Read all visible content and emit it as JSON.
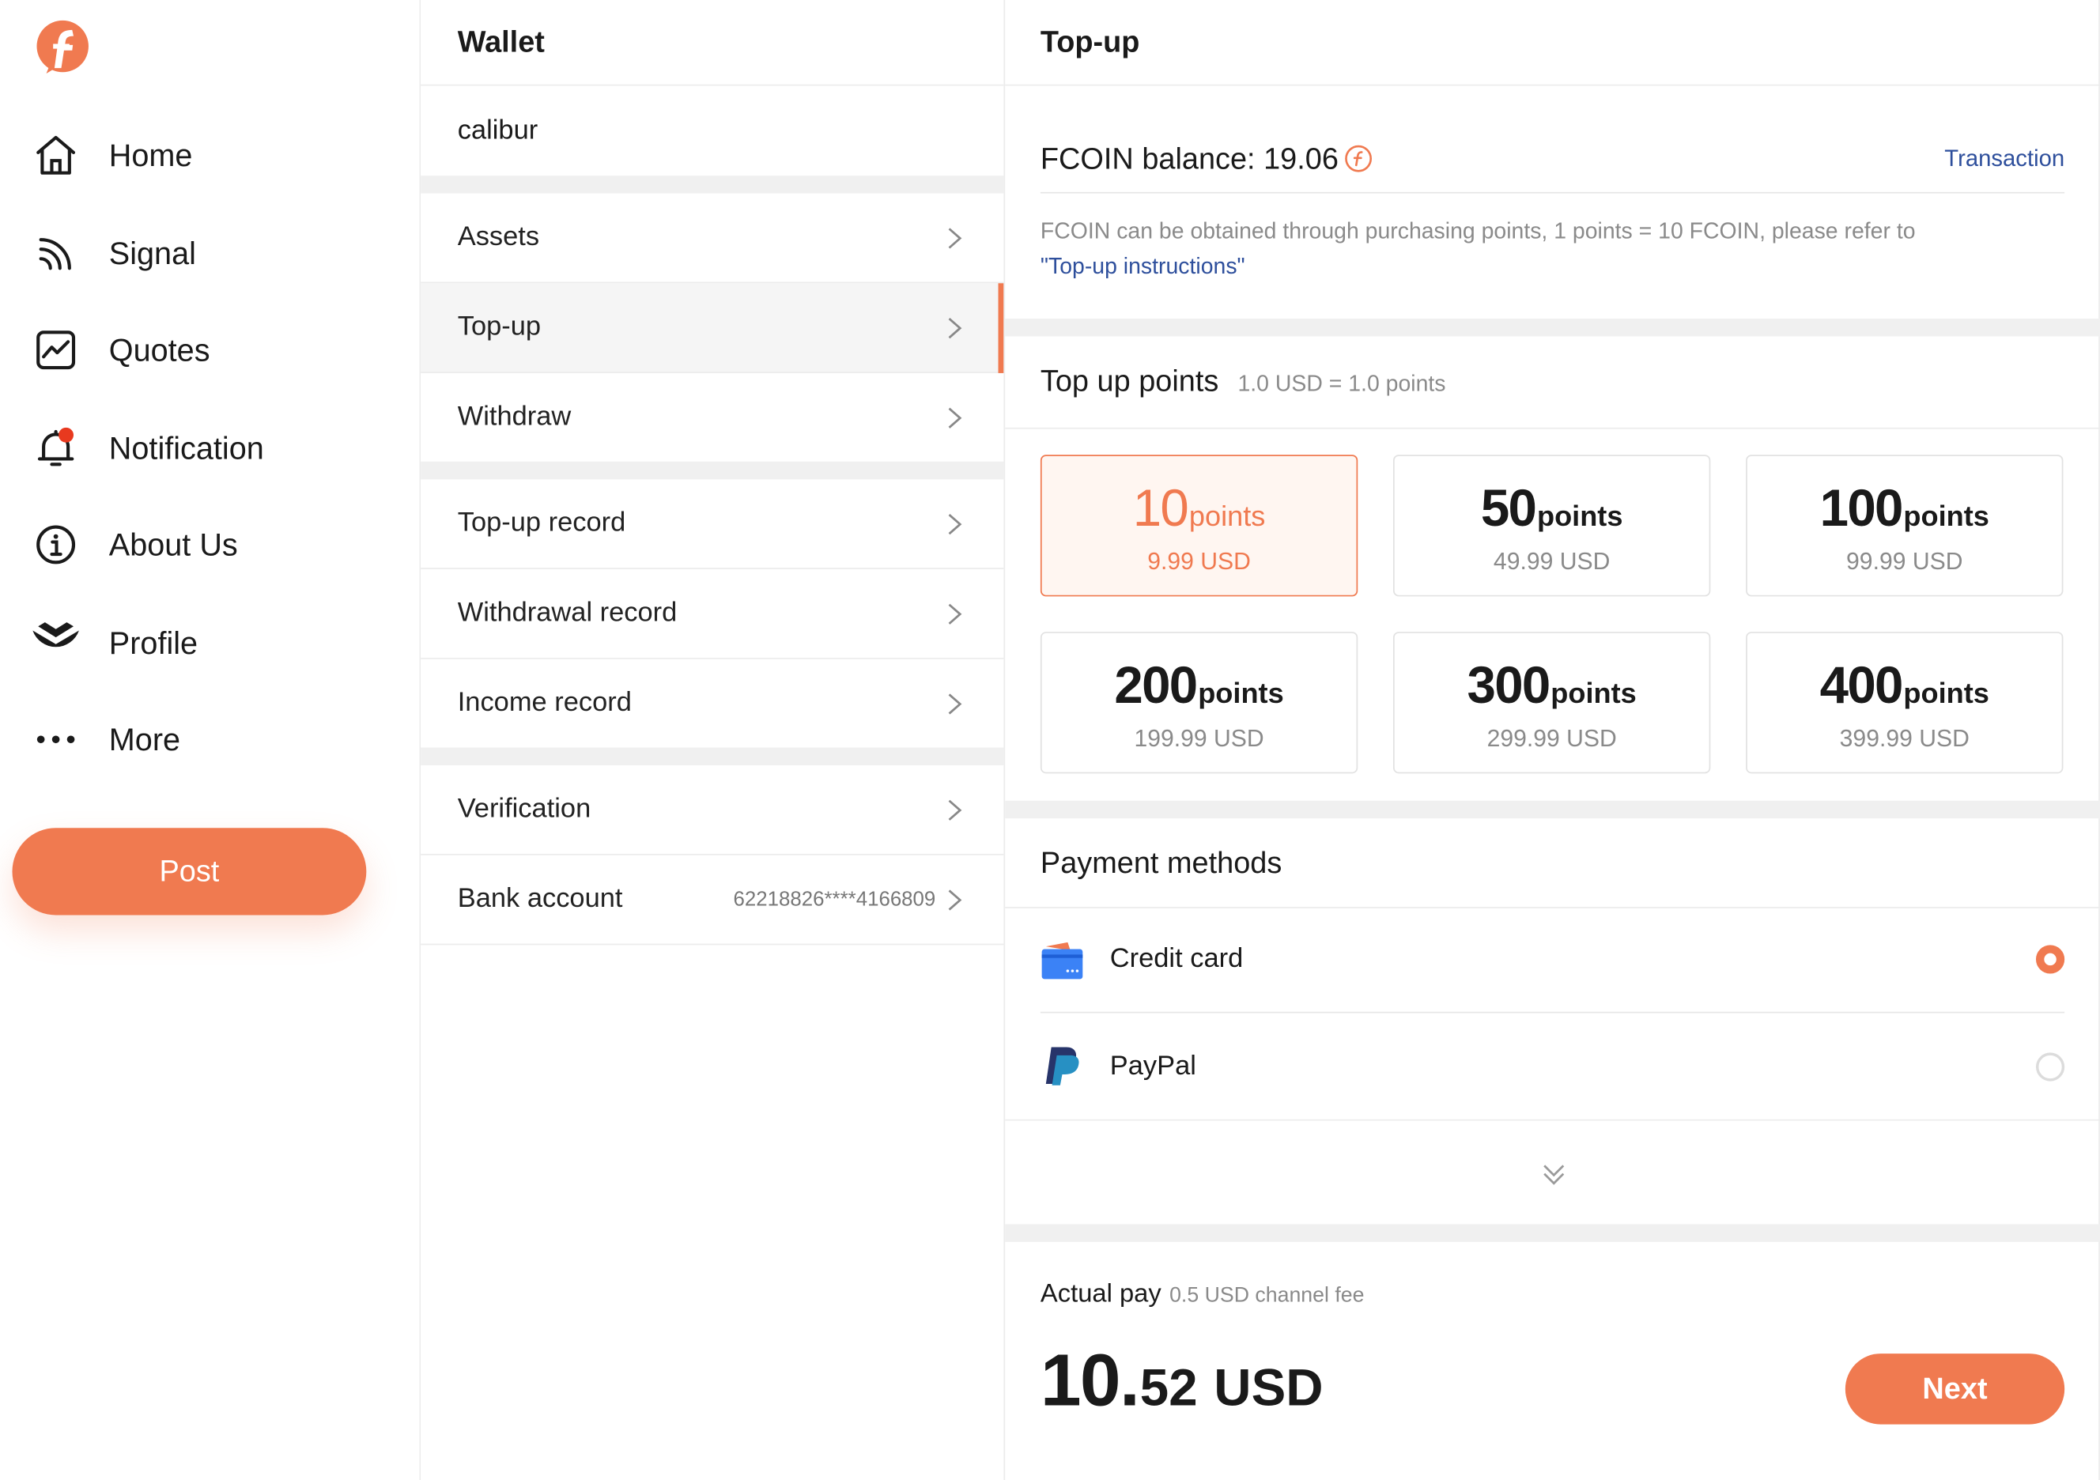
{
  "nav": {
    "items": [
      {
        "label": "Home",
        "icon": "home-icon"
      },
      {
        "label": "Signal",
        "icon": "signal-icon"
      },
      {
        "label": "Quotes",
        "icon": "quotes-icon"
      },
      {
        "label": "Notification",
        "icon": "bell-icon"
      },
      {
        "label": "About Us",
        "icon": "info-icon"
      },
      {
        "label": "Profile",
        "icon": "profile-icon"
      },
      {
        "label": "More",
        "icon": "more-dots-icon"
      }
    ],
    "post_label": "Post"
  },
  "wallet": {
    "title": "Wallet",
    "username": "calibur",
    "items": [
      {
        "label": "Assets"
      },
      {
        "label": "Top-up"
      },
      {
        "label": "Withdraw"
      },
      {
        "label": "Top-up record"
      },
      {
        "label": "Withdrawal record"
      },
      {
        "label": "Income record"
      },
      {
        "label": "Verification"
      },
      {
        "label": "Bank account",
        "value": "62218826****4166809"
      }
    ]
  },
  "topup": {
    "title": "Top-up",
    "balance_label": "FCOIN balance: 19.06",
    "transaction_label": "Transaction",
    "note_text": "FCOIN can be obtained through purchasing points, 1 points = 10 FCOIN, please refer to",
    "note_link": "\"Top-up instructions\"",
    "points_heading": "Top up points",
    "points_rate": "1.0 USD = 1.0 points",
    "options": [
      {
        "points": "10",
        "unit": "points",
        "price": "9.99  USD",
        "selected": true
      },
      {
        "points": "50",
        "unit": "points",
        "price": "49.99  USD",
        "selected": false
      },
      {
        "points": "100",
        "unit": "points",
        "price": "99.99  USD",
        "selected": false
      },
      {
        "points": "200",
        "unit": "points",
        "price": "199.99  USD",
        "selected": false
      },
      {
        "points": "300",
        "unit": "points",
        "price": "299.99  USD",
        "selected": false
      },
      {
        "points": "400",
        "unit": "points",
        "price": "399.99  USD",
        "selected": false
      }
    ],
    "payment_heading": "Payment methods",
    "payment_methods": [
      {
        "label": "Credit card",
        "icon": "credit-card-icon",
        "selected": true
      },
      {
        "label": "PayPal",
        "icon": "paypal-icon",
        "selected": false
      }
    ],
    "actual_pay_label": "Actual pay",
    "fee_note": "0.5 USD channel fee",
    "total_int": "10",
    "total_dec": "52",
    "total_currency": "USD",
    "next_label": "Next"
  },
  "colors": {
    "accent": "#f07a50",
    "link": "#2e4f9c",
    "notification_dot": "#e8391f"
  }
}
